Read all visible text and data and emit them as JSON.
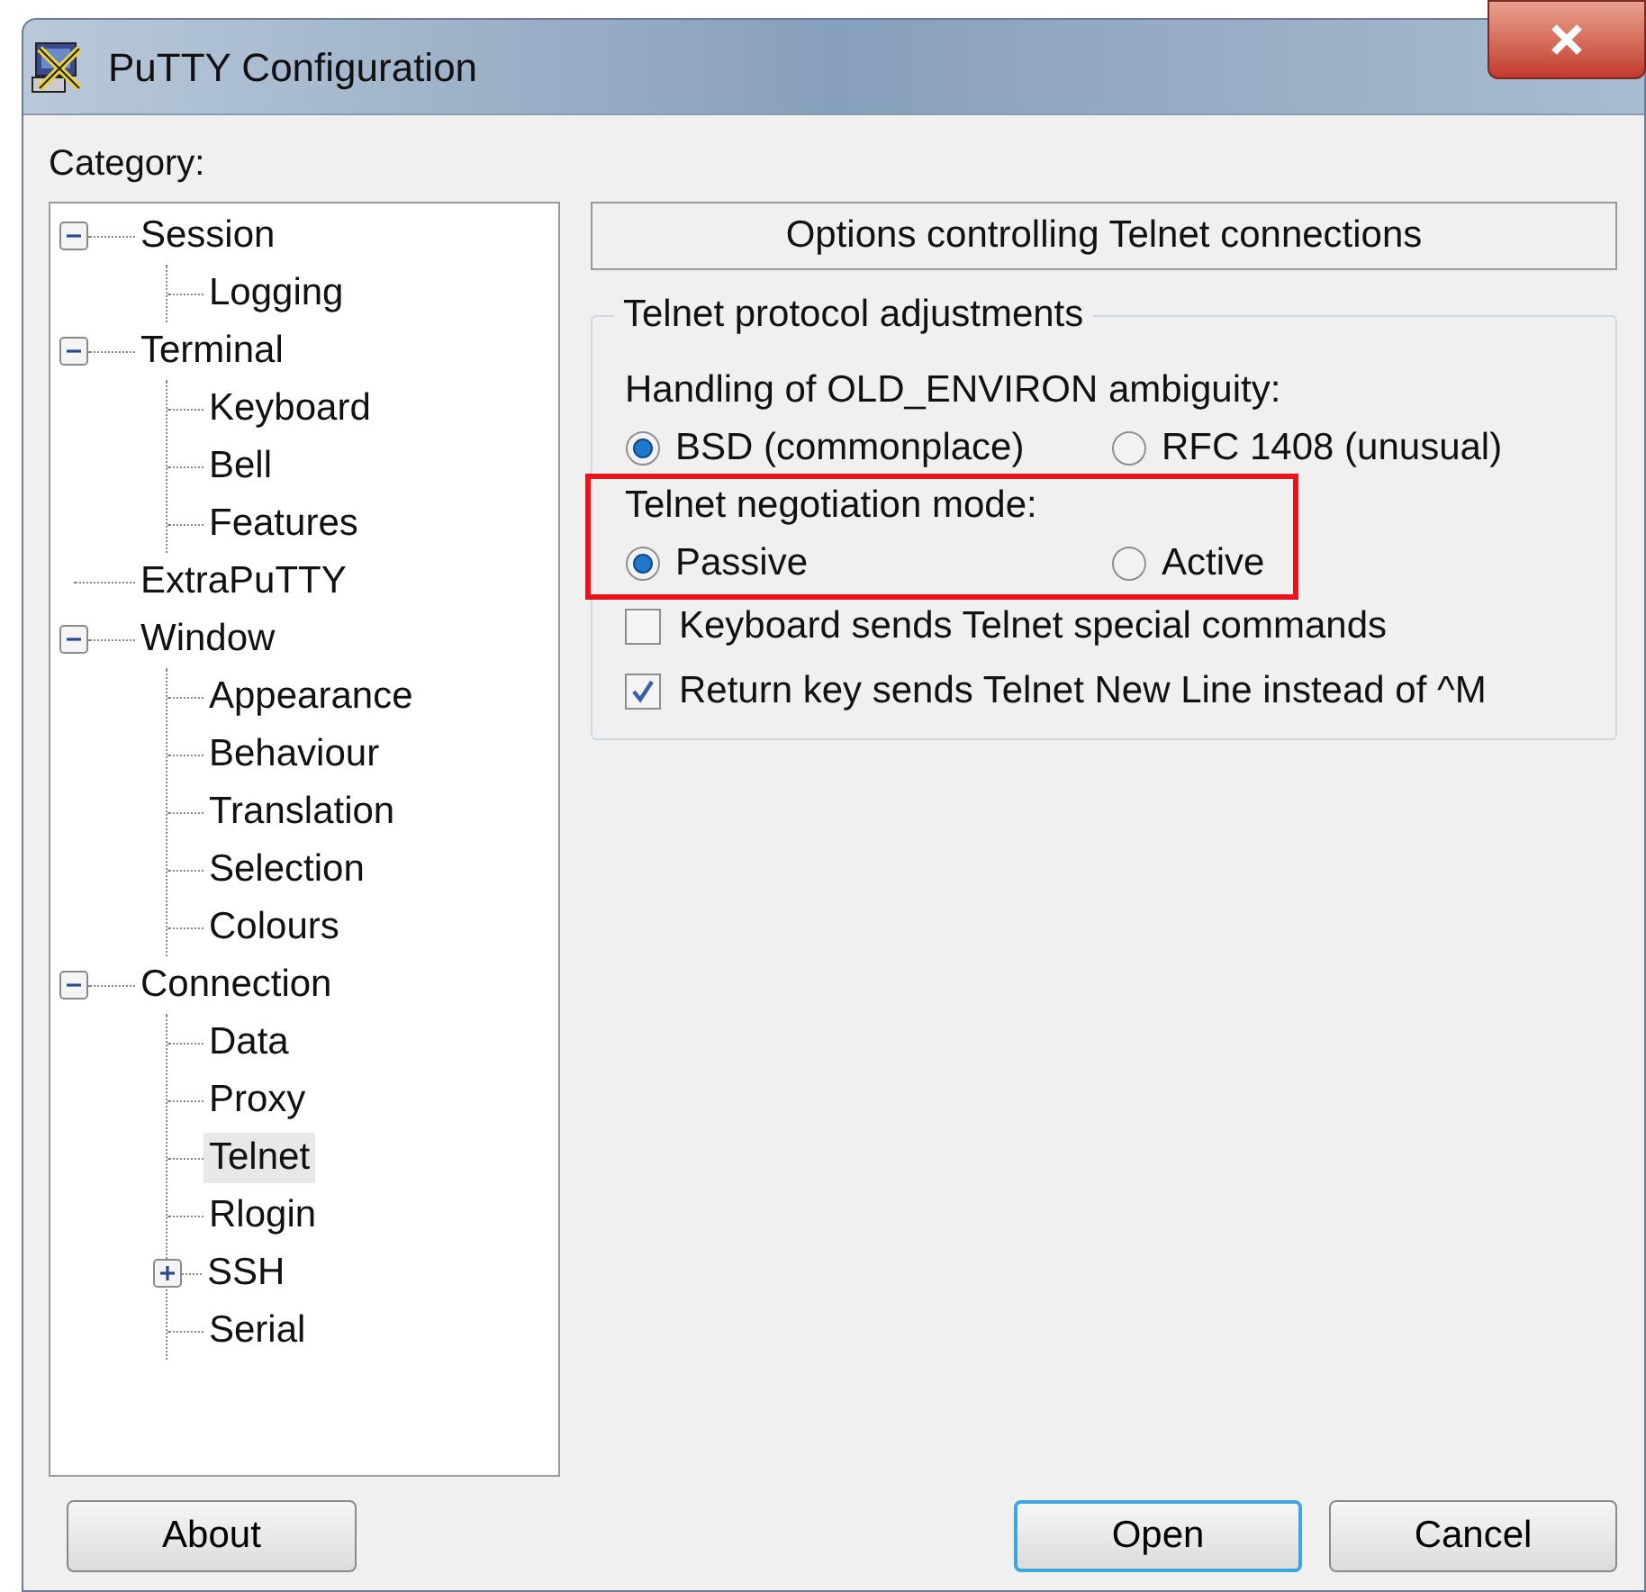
{
  "window": {
    "title": "PuTTY Configuration"
  },
  "category_label": "Category:",
  "tree": [
    {
      "label": "Session",
      "expanded": true,
      "selected": false,
      "children": [
        {
          "label": "Logging",
          "selected": false
        }
      ]
    },
    {
      "label": "Terminal",
      "expanded": true,
      "selected": false,
      "children": [
        {
          "label": "Keyboard",
          "selected": false
        },
        {
          "label": "Bell",
          "selected": false
        },
        {
          "label": "Features",
          "selected": false
        }
      ]
    },
    {
      "label": "ExtraPuTTY",
      "selected": false
    },
    {
      "label": "Window",
      "expanded": true,
      "selected": false,
      "children": [
        {
          "label": "Appearance",
          "selected": false
        },
        {
          "label": "Behaviour",
          "selected": false
        },
        {
          "label": "Translation",
          "selected": false
        },
        {
          "label": "Selection",
          "selected": false
        },
        {
          "label": "Colours",
          "selected": false
        }
      ]
    },
    {
      "label": "Connection",
      "expanded": true,
      "selected": false,
      "children": [
        {
          "label": "Data",
          "selected": false
        },
        {
          "label": "Proxy",
          "selected": false
        },
        {
          "label": "Telnet",
          "selected": true
        },
        {
          "label": "Rlogin",
          "selected": false
        },
        {
          "label": "SSH",
          "expanded": false,
          "selected": false
        },
        {
          "label": "Serial",
          "selected": false
        }
      ]
    }
  ],
  "panel": {
    "header": "Options controlling Telnet connections",
    "group": {
      "title": "Telnet protocol adjustments",
      "radio_groups": [
        {
          "label": "Handling of OLD_ENVIRON ambiguity:",
          "highlighted": false,
          "options": [
            {
              "label": "BSD (commonplace)",
              "selected": true
            },
            {
              "label": "RFC 1408 (unusual)",
              "selected": false
            }
          ]
        },
        {
          "label": "Telnet negotiation mode:",
          "highlighted": true,
          "options": [
            {
              "label": "Passive",
              "selected": true
            },
            {
              "label": "Active",
              "selected": false
            }
          ]
        }
      ],
      "checkboxes": [
        {
          "label": "Keyboard sends Telnet special commands",
          "checked": false
        },
        {
          "label": "Return key sends Telnet New Line instead of ^M",
          "checked": true
        }
      ]
    }
  },
  "buttons": [
    {
      "label": "About",
      "default": false
    },
    {
      "label": "Open",
      "default": true
    },
    {
      "label": "Cancel",
      "default": false
    }
  ]
}
